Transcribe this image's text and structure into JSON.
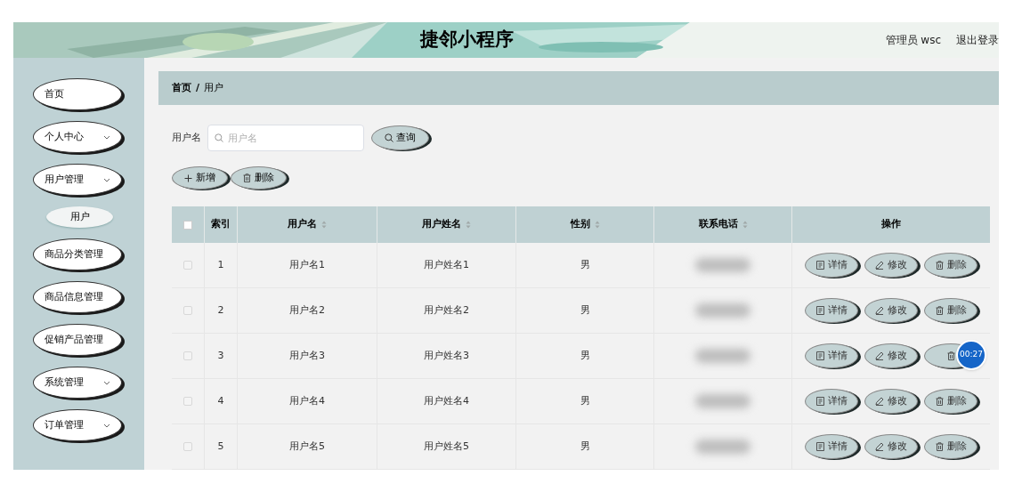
{
  "header": {
    "title": "捷邻小程序",
    "user": "管理员 wsc",
    "logout": "退出登录"
  },
  "sidebar": {
    "items": [
      {
        "label": "首页",
        "kind": "link",
        "selected": false
      },
      {
        "label": "个人中心",
        "kind": "submenu",
        "selected": false
      },
      {
        "label": "用户管理",
        "kind": "submenu",
        "selected": false,
        "children": [
          {
            "label": "用户",
            "selected": true
          }
        ]
      },
      {
        "label": "商品分类管理",
        "kind": "link",
        "selected": false
      },
      {
        "label": "商品信息管理",
        "kind": "link",
        "selected": false
      },
      {
        "label": "促销产品管理",
        "kind": "link",
        "selected": false
      },
      {
        "label": "系统管理",
        "kind": "submenu",
        "selected": false
      },
      {
        "label": "订单管理",
        "kind": "submenu",
        "selected": false
      }
    ]
  },
  "breadcrumb": [
    "首页",
    "/",
    "用户"
  ],
  "search": {
    "label": "用户名",
    "placeholder": "用户名",
    "button": "查询"
  },
  "toolbar": [
    {
      "kind": "add",
      "label": "新增"
    },
    {
      "kind": "delete",
      "label": "删除"
    }
  ],
  "table": {
    "header_checked": false,
    "columns": [
      {
        "label": "索引",
        "sortable": false
      },
      {
        "label": "用户名",
        "sortable": true
      },
      {
        "label": "用户姓名",
        "sortable": true
      },
      {
        "label": "性别",
        "sortable": true
      },
      {
        "label": "联系电话",
        "sortable": true
      },
      {
        "label": "操作",
        "sortable": false
      }
    ],
    "rows": [
      {
        "checked": false,
        "index": "1",
        "username": "用户名1",
        "realname": "用户姓名1",
        "gender": "男",
        "actions": [
          {
            "kind": "detail",
            "label": "详情"
          },
          {
            "kind": "edit",
            "label": "修改"
          },
          {
            "kind": "delete",
            "label": "删除"
          }
        ]
      },
      {
        "checked": false,
        "index": "2",
        "username": "用户名2",
        "realname": "用户姓名2",
        "gender": "男",
        "actions": [
          {
            "kind": "detail",
            "label": "详情"
          },
          {
            "kind": "edit",
            "label": "修改"
          },
          {
            "kind": "delete",
            "label": "删除"
          }
        ]
      },
      {
        "checked": false,
        "index": "3",
        "username": "用户名3",
        "realname": "用户姓名3",
        "gender": "男",
        "actions": [
          {
            "kind": "detail",
            "label": "详情"
          },
          {
            "kind": "edit",
            "label": "修改"
          },
          {
            "kind": "delete"
          }
        ],
        "timer_badge": "00:27"
      },
      {
        "checked": false,
        "index": "4",
        "username": "用户名4",
        "realname": "用户姓名4",
        "gender": "男",
        "actions": [
          {
            "kind": "detail",
            "label": "详情"
          },
          {
            "kind": "edit",
            "label": "修改"
          },
          {
            "kind": "delete",
            "label": "删除"
          }
        ]
      },
      {
        "checked": false,
        "index": "5",
        "username": "用户名5",
        "realname": "用户姓名5",
        "gender": "男",
        "actions": [
          {
            "kind": "detail",
            "label": "详情"
          },
          {
            "kind": "edit",
            "label": "修改"
          },
          {
            "kind": "delete",
            "label": "删除"
          }
        ]
      }
    ]
  }
}
